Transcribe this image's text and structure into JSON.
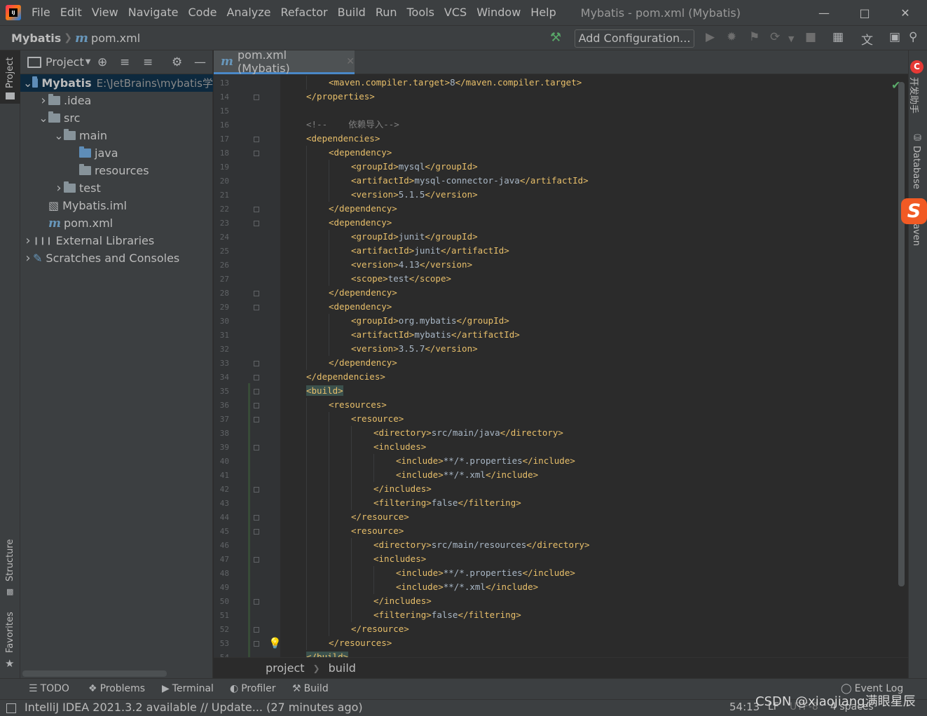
{
  "menubar": {
    "items": [
      "File",
      "Edit",
      "View",
      "Navigate",
      "Code",
      "Analyze",
      "Refactor",
      "Build",
      "Run",
      "Tools",
      "VCS",
      "Window",
      "Help"
    ],
    "window_title": "Mybatis - pom.xml (Mybatis)",
    "controls": [
      "minimize-icon",
      "maximize-icon",
      "close-icon"
    ]
  },
  "navbar": {
    "project": "Mybatis",
    "file": "pom.xml",
    "add_config": "Add Configuration..."
  },
  "left_stripe": {
    "project": "Project",
    "structure": "Structure",
    "favorites": "Favorites"
  },
  "project_panel": {
    "title": "Project",
    "tree": [
      {
        "label": "Mybatis",
        "path": "E:\\JetBrains\\mybatis学",
        "depth": 0,
        "expanded": true,
        "icon": "module-folder"
      },
      {
        "label": ".idea",
        "depth": 1,
        "expanded": false,
        "icon": "folder"
      },
      {
        "label": "src",
        "depth": 1,
        "expanded": true,
        "icon": "folder"
      },
      {
        "label": "main",
        "depth": 2,
        "expanded": true,
        "icon": "folder"
      },
      {
        "label": "java",
        "depth": 3,
        "icon": "source-folder"
      },
      {
        "label": "resources",
        "depth": 3,
        "icon": "resources-folder"
      },
      {
        "label": "test",
        "depth": 2,
        "expanded": false,
        "icon": "folder"
      },
      {
        "label": "Mybatis.iml",
        "depth": 1,
        "icon": "iml-file"
      },
      {
        "label": "pom.xml",
        "depth": 1,
        "icon": "maven-file"
      },
      {
        "label": "External Libraries",
        "depth": 0,
        "expanded": false,
        "icon": "libraries"
      },
      {
        "label": "Scratches and Consoles",
        "depth": 0,
        "expanded": false,
        "icon": "scratches"
      }
    ]
  },
  "editor": {
    "tab_label": "pom.xml (Mybatis)",
    "lines": [
      {
        "n": "13",
        "indent": 2,
        "parts": [
          [
            "tag",
            "<maven.compiler.target>"
          ],
          [
            "txt",
            "8"
          ],
          [
            "tag",
            "</maven.compiler.target>"
          ]
        ]
      },
      {
        "n": "14",
        "indent": 1,
        "parts": [
          [
            "tag",
            "</properties>"
          ]
        ]
      },
      {
        "n": "15",
        "indent": 0,
        "parts": []
      },
      {
        "n": "16",
        "indent": 1,
        "parts": [
          [
            "cmt",
            "<!--    依赖导入-->"
          ]
        ]
      },
      {
        "n": "17",
        "indent": 1,
        "parts": [
          [
            "tag",
            "<dependencies>"
          ]
        ]
      },
      {
        "n": "18",
        "indent": 2,
        "parts": [
          [
            "tag",
            "<dependency>"
          ]
        ]
      },
      {
        "n": "19",
        "indent": 3,
        "parts": [
          [
            "tag",
            "<groupId>"
          ],
          [
            "txt",
            "mysql"
          ],
          [
            "tag",
            "</groupId>"
          ]
        ]
      },
      {
        "n": "20",
        "indent": 3,
        "parts": [
          [
            "tag",
            "<artifactId>"
          ],
          [
            "txt",
            "mysql-connector-java"
          ],
          [
            "tag",
            "</artifactId>"
          ]
        ]
      },
      {
        "n": "21",
        "indent": 3,
        "parts": [
          [
            "tag",
            "<version>"
          ],
          [
            "txt",
            "5.1.5"
          ],
          [
            "tag",
            "</version>"
          ]
        ]
      },
      {
        "n": "22",
        "indent": 2,
        "parts": [
          [
            "tag",
            "</dependency>"
          ]
        ]
      },
      {
        "n": "23",
        "indent": 2,
        "parts": [
          [
            "tag",
            "<dependency>"
          ]
        ]
      },
      {
        "n": "24",
        "indent": 3,
        "parts": [
          [
            "tag",
            "<groupId>"
          ],
          [
            "txt",
            "junit"
          ],
          [
            "tag",
            "</groupId>"
          ]
        ]
      },
      {
        "n": "25",
        "indent": 3,
        "parts": [
          [
            "tag",
            "<artifactId>"
          ],
          [
            "txt",
            "junit"
          ],
          [
            "tag",
            "</artifactId>"
          ]
        ]
      },
      {
        "n": "26",
        "indent": 3,
        "parts": [
          [
            "tag",
            "<version>"
          ],
          [
            "txt",
            "4.13"
          ],
          [
            "tag",
            "</version>"
          ]
        ]
      },
      {
        "n": "27",
        "indent": 3,
        "parts": [
          [
            "tag",
            "<scope>"
          ],
          [
            "txt",
            "test"
          ],
          [
            "tag",
            "</scope>"
          ]
        ]
      },
      {
        "n": "28",
        "indent": 2,
        "parts": [
          [
            "tag",
            "</dependency>"
          ]
        ]
      },
      {
        "n": "29",
        "indent": 2,
        "parts": [
          [
            "tag",
            "<dependency>"
          ]
        ]
      },
      {
        "n": "30",
        "indent": 3,
        "parts": [
          [
            "tag",
            "<groupId>"
          ],
          [
            "txt",
            "org.mybatis"
          ],
          [
            "tag",
            "</groupId>"
          ]
        ]
      },
      {
        "n": "31",
        "indent": 3,
        "parts": [
          [
            "tag",
            "<artifactId>"
          ],
          [
            "txt",
            "mybatis"
          ],
          [
            "tag",
            "</artifactId>"
          ]
        ]
      },
      {
        "n": "32",
        "indent": 3,
        "parts": [
          [
            "tag",
            "<version>"
          ],
          [
            "txt",
            "3.5.7"
          ],
          [
            "tag",
            "</version>"
          ]
        ]
      },
      {
        "n": "33",
        "indent": 2,
        "parts": [
          [
            "tag",
            "</dependency>"
          ]
        ]
      },
      {
        "n": "34",
        "indent": 1,
        "parts": [
          [
            "tag",
            "</dependencies>"
          ]
        ]
      },
      {
        "n": "35",
        "indent": 1,
        "parts": [
          [
            "hl",
            "<build>"
          ]
        ]
      },
      {
        "n": "36",
        "indent": 2,
        "parts": [
          [
            "tag",
            "<resources>"
          ]
        ]
      },
      {
        "n": "37",
        "indent": 3,
        "parts": [
          [
            "tag",
            "<resource>"
          ]
        ]
      },
      {
        "n": "38",
        "indent": 4,
        "parts": [
          [
            "tag",
            "<directory>"
          ],
          [
            "txt",
            "src/main/java"
          ],
          [
            "tag",
            "</directory>"
          ]
        ]
      },
      {
        "n": "39",
        "indent": 4,
        "parts": [
          [
            "tag",
            "<includes>"
          ]
        ]
      },
      {
        "n": "40",
        "indent": 5,
        "parts": [
          [
            "tag",
            "<include>"
          ],
          [
            "txt",
            "**/*.properties"
          ],
          [
            "tag",
            "</include>"
          ]
        ]
      },
      {
        "n": "41",
        "indent": 5,
        "parts": [
          [
            "tag",
            "<include>"
          ],
          [
            "txt",
            "**/*.xml"
          ],
          [
            "tag",
            "</include>"
          ]
        ]
      },
      {
        "n": "42",
        "indent": 4,
        "parts": [
          [
            "tag",
            "</includes>"
          ]
        ]
      },
      {
        "n": "43",
        "indent": 4,
        "parts": [
          [
            "tag",
            "<filtering>"
          ],
          [
            "txt",
            "false"
          ],
          [
            "tag",
            "</filtering>"
          ]
        ]
      },
      {
        "n": "44",
        "indent": 3,
        "parts": [
          [
            "tag",
            "</resource>"
          ]
        ]
      },
      {
        "n": "45",
        "indent": 3,
        "parts": [
          [
            "tag",
            "<resource>"
          ]
        ]
      },
      {
        "n": "46",
        "indent": 4,
        "parts": [
          [
            "tag",
            "<directory>"
          ],
          [
            "txt",
            "src/main/resources"
          ],
          [
            "tag",
            "</directory>"
          ]
        ]
      },
      {
        "n": "47",
        "indent": 4,
        "parts": [
          [
            "tag",
            "<includes>"
          ]
        ]
      },
      {
        "n": "48",
        "indent": 5,
        "parts": [
          [
            "tag",
            "<include>"
          ],
          [
            "txt",
            "**/*.properties"
          ],
          [
            "tag",
            "</include>"
          ]
        ]
      },
      {
        "n": "49",
        "indent": 5,
        "parts": [
          [
            "tag",
            "<include>"
          ],
          [
            "txt",
            "**/*.xml"
          ],
          [
            "tag",
            "</include>"
          ]
        ]
      },
      {
        "n": "50",
        "indent": 4,
        "parts": [
          [
            "tag",
            "</includes>"
          ]
        ]
      },
      {
        "n": "51",
        "indent": 4,
        "parts": [
          [
            "tag",
            "<filtering>"
          ],
          [
            "txt",
            "false"
          ],
          [
            "tag",
            "</filtering>"
          ]
        ]
      },
      {
        "n": "52",
        "indent": 3,
        "parts": [
          [
            "tag",
            "</resource>"
          ]
        ]
      },
      {
        "n": "53",
        "indent": 2,
        "parts": [
          [
            "tag",
            "</resources>"
          ]
        ]
      },
      {
        "n": "54",
        "indent": 1,
        "parts": [
          [
            "hl",
            "</build>"
          ]
        ]
      }
    ]
  },
  "breadcrumb": {
    "items": [
      "project",
      "build"
    ]
  },
  "right_stripe": {
    "helper": "开发助手",
    "database": "Database",
    "maven": "Maven"
  },
  "bottom_tools": {
    "todo": "TODO",
    "problems": "Problems",
    "terminal": "Terminal",
    "profiler": "Profiler",
    "build": "Build",
    "event_log": "Event Log"
  },
  "statusbar": {
    "message": "IntelliJ IDEA 2021.3.2 available // Update... (27 minutes ago)",
    "caret": "54:13",
    "line_sep": "LF",
    "encoding": "UTF-8",
    "indent": "4 spaces",
    "watermark": "CSDN @xiaojiang满眼星辰"
  },
  "colors": {
    "tag": "#e8bf6a",
    "text": "#a9b7c6",
    "comment": "#808080",
    "selection": "#0d293e",
    "accent": "#4a88c7"
  }
}
